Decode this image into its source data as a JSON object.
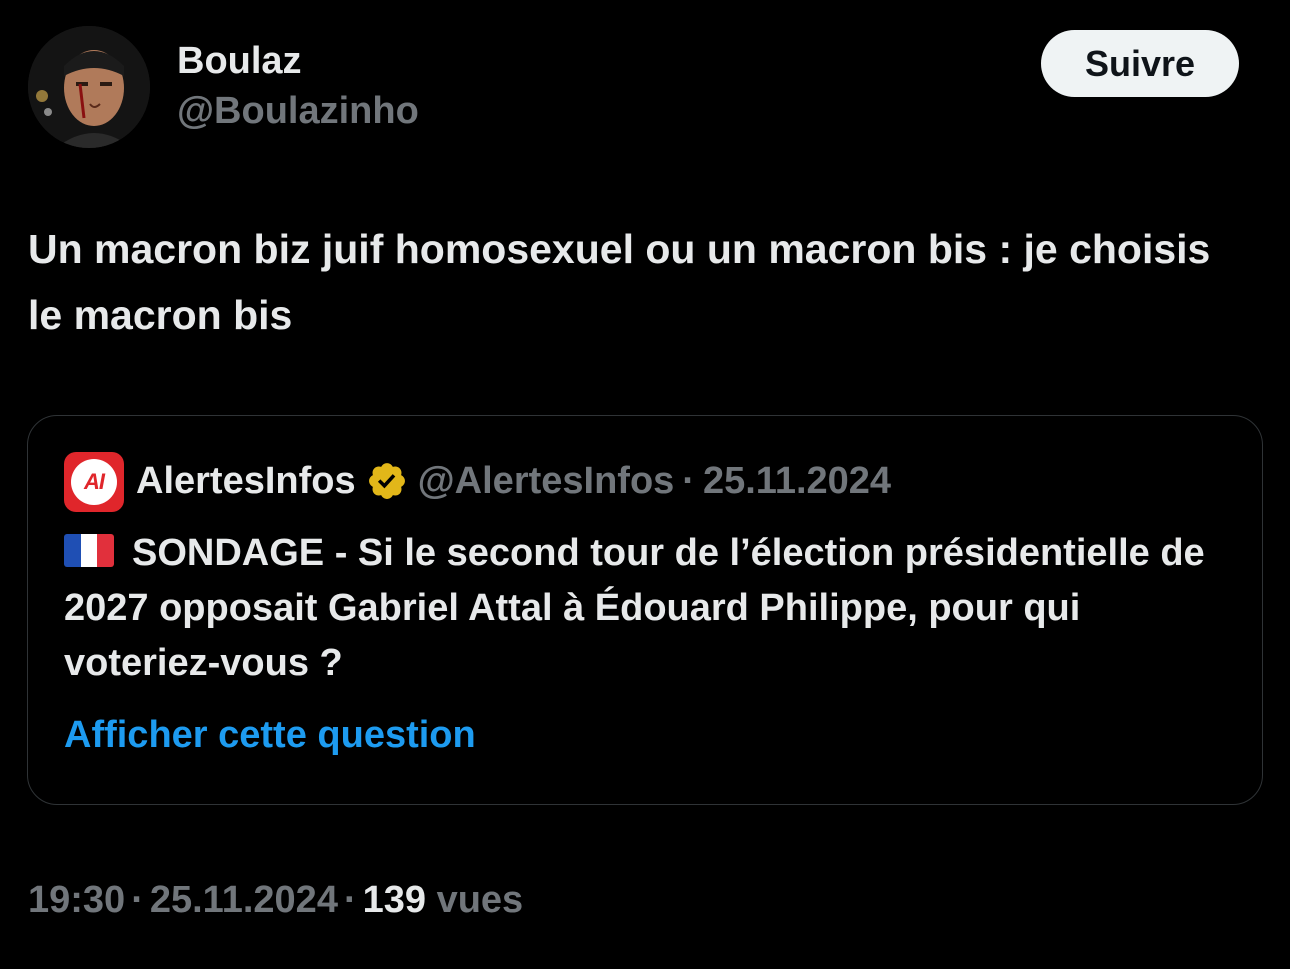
{
  "author": {
    "display_name": "Boulaz",
    "handle": "@Boulazinho",
    "avatar_icon": "avatar-photo"
  },
  "follow_button": {
    "label": "Suivre"
  },
  "tweet": {
    "text": "Un macron biz juif homosexuel ou un macron bis : je choisis le macron bis"
  },
  "quote": {
    "logo_icon": "alertesinfos-logo",
    "logo_text": "AI",
    "name": "AlertesInfos",
    "verified_icon": "verified-badge-gold",
    "handle": "@AlertesInfos",
    "separator": "·",
    "date": "25.11.2024",
    "flag_icon": "france-flag",
    "body": "SONDAGE - Si le second tour de l’élection présidentielle de 2027 opposait Gabriel Attal à Édouard Philippe, pour qui voteriez-vous ?",
    "show_question_link": "Afficher cette question"
  },
  "meta": {
    "time": "19:30",
    "separator": "·",
    "date": "25.11.2024",
    "views_count": "139",
    "views_label": "vues"
  },
  "colors": {
    "background": "#000000",
    "text_primary": "#e7e9ea",
    "text_secondary": "#71767b",
    "link": "#1d9bf0",
    "follow_button_bg": "#eff3f4",
    "brand_red": "#e0262b",
    "verified_gold": "#e2b719"
  }
}
